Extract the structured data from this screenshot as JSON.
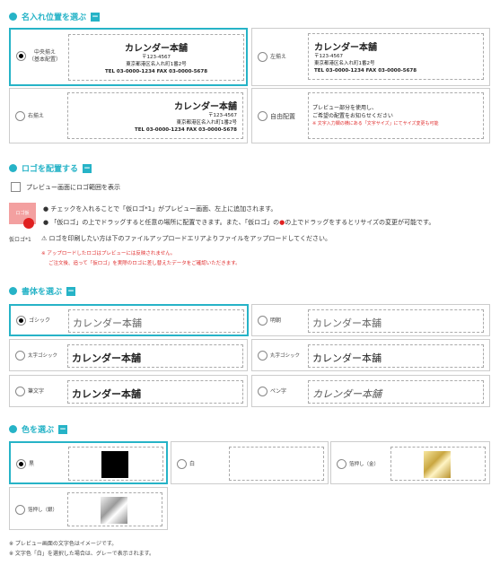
{
  "sections": {
    "name_position": "名入れ位置を選ぶ",
    "logo": "ロゴを配置する",
    "font": "書体を選ぶ",
    "color": "色を選ぶ"
  },
  "toggle_symbol": "−",
  "address": {
    "name": "カレンダー本舗",
    "zip": "〒123-4567",
    "line": "東京都港区名入れ町1番2号",
    "tel": "TEL 03-0000-1234 FAX 03-0000-5678"
  },
  "positions": [
    {
      "label": "中央揃え",
      "sub": "（基本配置）"
    },
    {
      "label": "左揃え",
      "sub": ""
    },
    {
      "label": "右揃え",
      "sub": ""
    },
    {
      "label": "自由配置",
      "sub": ""
    }
  ],
  "free_preview": {
    "line1": "プレビュー部分を使用し、",
    "line2": "ご希望の配置をお知らせください",
    "note": "※ 文字入力欄の横にある「文字サイズ」にてサイズ変更も可能"
  },
  "logo": {
    "checkbox_label": "プレビュー画面にロゴ範囲を表示",
    "badge": "ロゴ仮",
    "caption": "仮ロゴ*1",
    "bullet1": "チェックを入れることで「仮ロゴ*1」がプレビュー画面、左上に追加されます。",
    "bullet2a": "「仮ロゴ」の上でドラッグすると任意の場所に配置できます。また、「仮ロゴ」の",
    "bullet2b": "の上でドラッグをするとリサイズの変更が可能です。",
    "warning": "ロゴを印刷したい方は下のファイルアップロードエリアよりファイルをアップロードしてください。",
    "note1": "※ アップロードしたロゴはプレビューには反映されません。",
    "note2": "ご注文後、追って「仮ロゴ」を実際のロゴに差し替えたデータをご確認いただきます。"
  },
  "fonts": [
    {
      "label": "ゴシック",
      "sample": "カレンダー本舗"
    },
    {
      "label": "明朝",
      "sample": "カレンダー本舗"
    },
    {
      "label": "太字ゴシック",
      "sample": "カレンダー本舗"
    },
    {
      "label": "丸字ゴシック",
      "sample": "カレンダー本舗"
    },
    {
      "label": "筆文字",
      "sample": "カレンダー本舗"
    },
    {
      "label": "ペン字",
      "sample": "カレンダー本舗"
    }
  ],
  "colors": [
    {
      "label": "黒",
      "hex": "#000000"
    },
    {
      "label": "白",
      "hex": "#ffffff"
    },
    {
      "label": "箔押し（金）",
      "hex": "#e0c060"
    },
    {
      "label": "箔押し（銀）",
      "hex": "#b0b0b0"
    }
  ],
  "footer": {
    "note1": "※ プレビュー画面の文字色はイメージです。",
    "note2": "※ 文字色「白」を選択した場合は、グレーで表示されます。"
  },
  "theme": {
    "accent": "#26b3c7",
    "alert": "#e03030"
  }
}
